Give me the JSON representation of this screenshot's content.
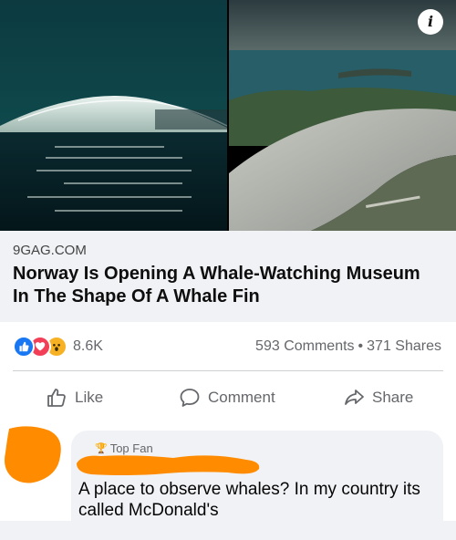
{
  "media": {
    "info_icon": "info-icon",
    "info_label": "i"
  },
  "link": {
    "domain": "9GAG.COM",
    "title": "Norway Is Opening A Whale-Watching Museum In The Shape Of A Whale Fin"
  },
  "stats": {
    "reaction_icons": [
      "like-reaction-icon",
      "love-reaction-icon",
      "wow-reaction-icon"
    ],
    "reaction_count": "8.6K",
    "comments": "593 Comments",
    "separator": "•",
    "shares": "371 Shares"
  },
  "actions": {
    "like": "Like",
    "comment": "Comment",
    "share": "Share"
  },
  "comment": {
    "badge": "Top Fan",
    "text": "A place to observe whales? In my country its called McDonald's"
  },
  "colors": {
    "facebook_blue": "#1877f2",
    "love_red": "#f33e58",
    "wow_yellow": "#f7b125",
    "redaction_orange": "#ff8c00",
    "muted_text": "#65676b"
  }
}
